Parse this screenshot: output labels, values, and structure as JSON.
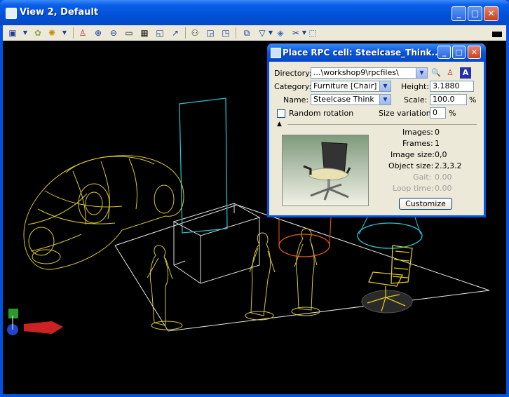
{
  "window": {
    "title": "View 2, Default",
    "min": "_",
    "max": "□",
    "close": "✕"
  },
  "toolbar": {
    "icons": [
      "view-attributes-icon",
      "view-display-icon",
      "render-icon",
      "brightness-icon",
      "zoom-in-icon",
      "zoom-out-icon",
      "window-area-icon",
      "fit-view-icon",
      "rotate-view-icon",
      "pan-view-icon",
      "walk-icon",
      "view-previous-icon",
      "view-next-icon",
      "copy-view-icon",
      "clip-volume-icon",
      "clip-mask-icon",
      "camera-icon",
      "display-set-icon"
    ]
  },
  "dialog": {
    "title": "Place RPC cell: Steelcase_Think...",
    "directory_label": "Directory:",
    "directory_value": "...\\workshop9\\rpcfiles\\",
    "category_label": "Category:",
    "category_value": "Furniture [Chair]",
    "name_label": "Name:",
    "name_value": "Steelcase Think",
    "height_label": "Height:",
    "height_value": "3.1880",
    "scale_label": "Scale:",
    "scale_value": "100.0",
    "scale_unit": "%",
    "random_rotation_label": "Random rotation",
    "size_variation_label": "Size variation:",
    "size_variation_value": "0",
    "size_variation_unit": "%",
    "info": [
      {
        "label": "Images:",
        "value": "0",
        "disabled": false
      },
      {
        "label": "Frames:",
        "value": "1",
        "disabled": false
      },
      {
        "label": "Image size:",
        "value": "0,0",
        "disabled": false
      },
      {
        "label": "Object size:",
        "value": "2.3,3.2",
        "disabled": false
      },
      {
        "label": "Gait:",
        "value": "0.00",
        "disabled": true
      },
      {
        "label": "Loop time:",
        "value": "0.00",
        "disabled": true
      }
    ],
    "customize_label": "Customize"
  }
}
